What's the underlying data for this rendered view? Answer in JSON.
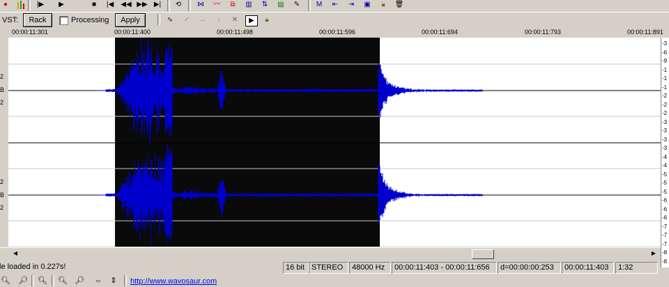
{
  "toolbar1": {
    "icons": [
      "record-icon",
      "meter-icon",
      "play-from-start-icon",
      "play-icon",
      "stop-icon",
      "rewind-icon",
      "fast-forward-icon",
      "skip-end-icon",
      "loop-icon",
      "waveform-tool-icon",
      "envelope-icon",
      "copy-icon",
      "spectrum-icon",
      "normalize-icon",
      "equalizer-icon",
      "pencil-icon",
      "marker-icon",
      "move-left-icon",
      "move-right-icon",
      "video-icon",
      "lock-icon",
      "trash-icon"
    ]
  },
  "toolbar2": {
    "vst_label": "VST:",
    "rack_label": "Rack",
    "processing_label": "Processing",
    "apply_label": "Apply"
  },
  "ruler": {
    "ticks": [
      "00:00:11:301",
      "00:00:11:400",
      "00:00:11:498",
      "00:00:11:596",
      "00:00:11:694",
      "00:00:11:793",
      "00:00:11:891"
    ]
  },
  "left_scale": {
    "ch1": [
      "2",
      "B",
      "2"
    ],
    "ch2": [
      "2",
      "B",
      "2"
    ]
  },
  "right_scale": {
    "labels": [
      "-3",
      "-6",
      "-9",
      "-1",
      "-1",
      "-1",
      "-2",
      "-2",
      "-2",
      "-3",
      "-3",
      "-3",
      "-3",
      "-4",
      "-4",
      "-5",
      "-5",
      "-5",
      "-6",
      "-6",
      "-6",
      "-7",
      "-7",
      "-7",
      "-8",
      "-8"
    ]
  },
  "status": {
    "message": "le loaded in 0.227s!",
    "bits": "16 bit",
    "mode": "STEREO",
    "rate": "48000 Hz",
    "selection": "00:00:11:403 - 00:00:11:656",
    "duration": "d=00:00:00:253",
    "position": "00:00:11:403",
    "zoom": "1:32"
  },
  "bottombar": {
    "link": "http://www.wavosaur.com"
  },
  "colors": {
    "wave": "#0000cc",
    "selection_bg": "#0a0a0a",
    "background": "#ffffff",
    "chrome": "#d4d0c8"
  }
}
